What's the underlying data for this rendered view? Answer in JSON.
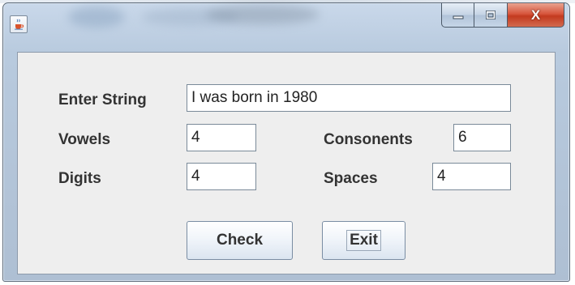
{
  "window": {
    "title": ""
  },
  "title_bar": {
    "app_icon": "java-cup-icon",
    "controls": {
      "minimize_icon": "minimize-icon",
      "maximize_icon": "maximize-icon",
      "close_icon": "close-icon",
      "close_glyph": "X"
    }
  },
  "form": {
    "input": {
      "label": "Enter String",
      "value": "I was born in 1980"
    },
    "vowels": {
      "label": "Vowels",
      "value": "4"
    },
    "consonants": {
      "label": "Consonents",
      "value": "6"
    },
    "digits": {
      "label": "Digits",
      "value": "4"
    },
    "spaces": {
      "label": "Spaces",
      "value": "4"
    }
  },
  "buttons": {
    "check": "Check",
    "exit": "Exit"
  },
  "colors": {
    "close_button": "#c33a1f",
    "panel_background": "#eeeeee",
    "frame": "#aebfd3"
  }
}
